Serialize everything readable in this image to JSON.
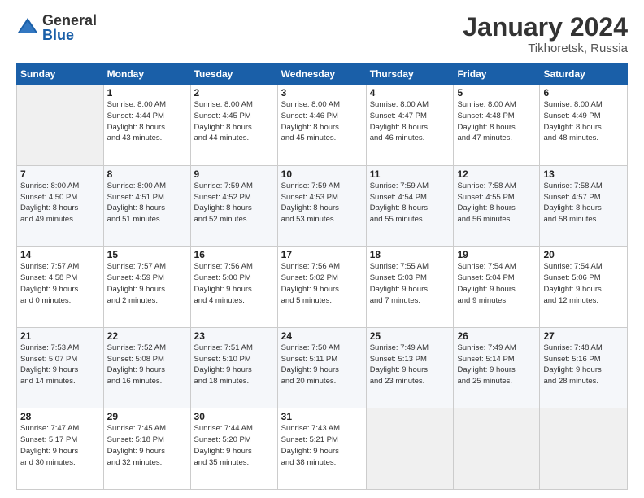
{
  "header": {
    "logo_general": "General",
    "logo_blue": "Blue",
    "month_title": "January 2024",
    "location": "Tikhoretsk, Russia"
  },
  "days_of_week": [
    "Sunday",
    "Monday",
    "Tuesday",
    "Wednesday",
    "Thursday",
    "Friday",
    "Saturday"
  ],
  "weeks": [
    [
      {
        "day": "",
        "info": ""
      },
      {
        "day": "1",
        "info": "Sunrise: 8:00 AM\nSunset: 4:44 PM\nDaylight: 8 hours\nand 43 minutes."
      },
      {
        "day": "2",
        "info": "Sunrise: 8:00 AM\nSunset: 4:45 PM\nDaylight: 8 hours\nand 44 minutes."
      },
      {
        "day": "3",
        "info": "Sunrise: 8:00 AM\nSunset: 4:46 PM\nDaylight: 8 hours\nand 45 minutes."
      },
      {
        "day": "4",
        "info": "Sunrise: 8:00 AM\nSunset: 4:47 PM\nDaylight: 8 hours\nand 46 minutes."
      },
      {
        "day": "5",
        "info": "Sunrise: 8:00 AM\nSunset: 4:48 PM\nDaylight: 8 hours\nand 47 minutes."
      },
      {
        "day": "6",
        "info": "Sunrise: 8:00 AM\nSunset: 4:49 PM\nDaylight: 8 hours\nand 48 minutes."
      }
    ],
    [
      {
        "day": "7",
        "info": "Sunrise: 8:00 AM\nSunset: 4:50 PM\nDaylight: 8 hours\nand 49 minutes."
      },
      {
        "day": "8",
        "info": "Sunrise: 8:00 AM\nSunset: 4:51 PM\nDaylight: 8 hours\nand 51 minutes."
      },
      {
        "day": "9",
        "info": "Sunrise: 7:59 AM\nSunset: 4:52 PM\nDaylight: 8 hours\nand 52 minutes."
      },
      {
        "day": "10",
        "info": "Sunrise: 7:59 AM\nSunset: 4:53 PM\nDaylight: 8 hours\nand 53 minutes."
      },
      {
        "day": "11",
        "info": "Sunrise: 7:59 AM\nSunset: 4:54 PM\nDaylight: 8 hours\nand 55 minutes."
      },
      {
        "day": "12",
        "info": "Sunrise: 7:58 AM\nSunset: 4:55 PM\nDaylight: 8 hours\nand 56 minutes."
      },
      {
        "day": "13",
        "info": "Sunrise: 7:58 AM\nSunset: 4:57 PM\nDaylight: 8 hours\nand 58 minutes."
      }
    ],
    [
      {
        "day": "14",
        "info": "Sunrise: 7:57 AM\nSunset: 4:58 PM\nDaylight: 9 hours\nand 0 minutes."
      },
      {
        "day": "15",
        "info": "Sunrise: 7:57 AM\nSunset: 4:59 PM\nDaylight: 9 hours\nand 2 minutes."
      },
      {
        "day": "16",
        "info": "Sunrise: 7:56 AM\nSunset: 5:00 PM\nDaylight: 9 hours\nand 4 minutes."
      },
      {
        "day": "17",
        "info": "Sunrise: 7:56 AM\nSunset: 5:02 PM\nDaylight: 9 hours\nand 5 minutes."
      },
      {
        "day": "18",
        "info": "Sunrise: 7:55 AM\nSunset: 5:03 PM\nDaylight: 9 hours\nand 7 minutes."
      },
      {
        "day": "19",
        "info": "Sunrise: 7:54 AM\nSunset: 5:04 PM\nDaylight: 9 hours\nand 9 minutes."
      },
      {
        "day": "20",
        "info": "Sunrise: 7:54 AM\nSunset: 5:06 PM\nDaylight: 9 hours\nand 12 minutes."
      }
    ],
    [
      {
        "day": "21",
        "info": "Sunrise: 7:53 AM\nSunset: 5:07 PM\nDaylight: 9 hours\nand 14 minutes."
      },
      {
        "day": "22",
        "info": "Sunrise: 7:52 AM\nSunset: 5:08 PM\nDaylight: 9 hours\nand 16 minutes."
      },
      {
        "day": "23",
        "info": "Sunrise: 7:51 AM\nSunset: 5:10 PM\nDaylight: 9 hours\nand 18 minutes."
      },
      {
        "day": "24",
        "info": "Sunrise: 7:50 AM\nSunset: 5:11 PM\nDaylight: 9 hours\nand 20 minutes."
      },
      {
        "day": "25",
        "info": "Sunrise: 7:49 AM\nSunset: 5:13 PM\nDaylight: 9 hours\nand 23 minutes."
      },
      {
        "day": "26",
        "info": "Sunrise: 7:49 AM\nSunset: 5:14 PM\nDaylight: 9 hours\nand 25 minutes."
      },
      {
        "day": "27",
        "info": "Sunrise: 7:48 AM\nSunset: 5:16 PM\nDaylight: 9 hours\nand 28 minutes."
      }
    ],
    [
      {
        "day": "28",
        "info": "Sunrise: 7:47 AM\nSunset: 5:17 PM\nDaylight: 9 hours\nand 30 minutes."
      },
      {
        "day": "29",
        "info": "Sunrise: 7:45 AM\nSunset: 5:18 PM\nDaylight: 9 hours\nand 32 minutes."
      },
      {
        "day": "30",
        "info": "Sunrise: 7:44 AM\nSunset: 5:20 PM\nDaylight: 9 hours\nand 35 minutes."
      },
      {
        "day": "31",
        "info": "Sunrise: 7:43 AM\nSunset: 5:21 PM\nDaylight: 9 hours\nand 38 minutes."
      },
      {
        "day": "",
        "info": ""
      },
      {
        "day": "",
        "info": ""
      },
      {
        "day": "",
        "info": ""
      }
    ]
  ]
}
